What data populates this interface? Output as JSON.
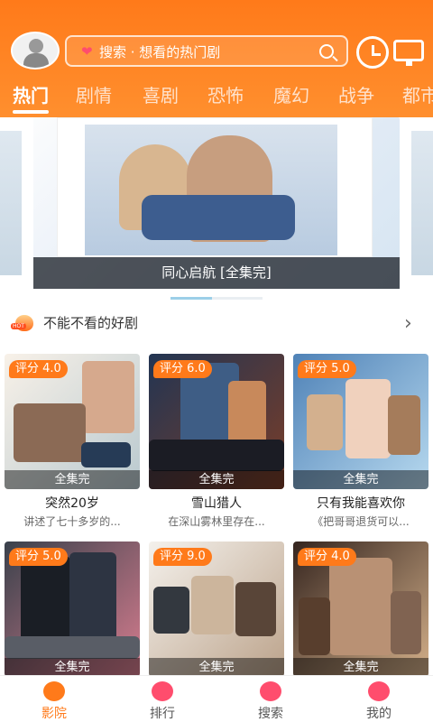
{
  "header": {
    "search_placeholder": "搜索 · 想看的热门剧"
  },
  "tabs": [
    {
      "label": "热门",
      "active": true
    },
    {
      "label": "剧情",
      "active": false
    },
    {
      "label": "喜剧",
      "active": false
    },
    {
      "label": "恐怖",
      "active": false
    },
    {
      "label": "魔幻",
      "active": false
    },
    {
      "label": "战争",
      "active": false
    },
    {
      "label": "都市",
      "active": false
    }
  ],
  "banner": {
    "caption": "同心启航 [全集完]",
    "progress": 0.45
  },
  "section": {
    "title": "不能不看的好剧"
  },
  "items": [
    {
      "score": "评分 4.0",
      "status": "全集完",
      "title": "突然20岁",
      "desc": "讲述了七十多岁的..."
    },
    {
      "score": "评分 6.0",
      "status": "全集完",
      "title": "雪山猎人",
      "desc": "在深山雾林里存在..."
    },
    {
      "score": "评分 5.0",
      "status": "全集完",
      "title": "只有我能喜欢你",
      "desc": "《把哥哥退货可以..."
    },
    {
      "score": "评分 5.0",
      "status": "全集完",
      "title": "",
      "desc": ""
    },
    {
      "score": "评分 9.0",
      "status": "全集完",
      "title": "",
      "desc": ""
    },
    {
      "score": "评分 4.0",
      "status": "全集完",
      "title": "",
      "desc": ""
    }
  ],
  "bottom_nav": [
    {
      "label": "影院",
      "active": true,
      "icon": "home-icon"
    },
    {
      "label": "排行",
      "active": false,
      "icon": "ranking-icon"
    },
    {
      "label": "搜索",
      "active": false,
      "icon": "search-icon"
    },
    {
      "label": "我的",
      "active": false,
      "icon": "profile-icon"
    }
  ],
  "colors": {
    "brand": "#ff7a1a",
    "accent": "#ff4d6d"
  }
}
